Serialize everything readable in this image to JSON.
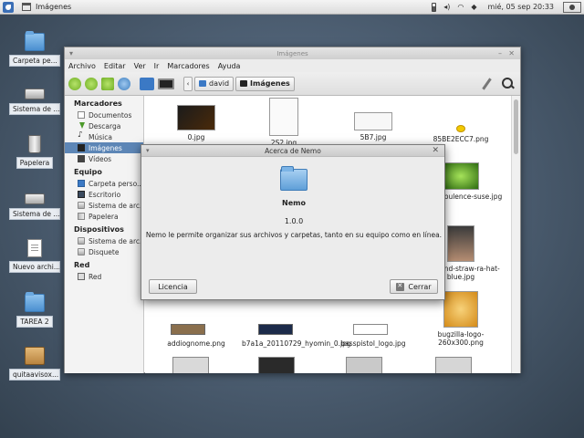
{
  "panel": {
    "task_title": "Imágenes",
    "datetime": "mié, 05 sep  20:33"
  },
  "desktop": {
    "icons": [
      {
        "label": "Carpeta pe...",
        "icon": "folder-icon"
      },
      {
        "label": "Sistema de ...",
        "icon": "drive-icon"
      },
      {
        "label": "Papelera",
        "icon": "trash-icon"
      },
      {
        "label": "Sistema de ...",
        "icon": "drive-icon"
      },
      {
        "label": "Nuevo archi...",
        "icon": "document-icon"
      },
      {
        "label": "TAREA 2",
        "icon": "folder-icon"
      },
      {
        "label": "quitaavisox...",
        "icon": "package-icon"
      }
    ]
  },
  "window": {
    "title": "Imágenes",
    "menu": [
      "Archivo",
      "Editar",
      "Ver",
      "Ir",
      "Marcadores",
      "Ayuda"
    ],
    "path": {
      "parent": "david",
      "current": "Imágenes"
    }
  },
  "sidebar": {
    "sections": [
      {
        "title": "Marcadores",
        "items": [
          {
            "label": "Documentos",
            "icon": "doc"
          },
          {
            "label": "Descarga",
            "icon": "down"
          },
          {
            "label": "Música",
            "icon": "music"
          },
          {
            "label": "Imágenes",
            "icon": "img",
            "selected": true
          },
          {
            "label": "Vídeos",
            "icon": "vid"
          }
        ]
      },
      {
        "title": "Equipo",
        "items": [
          {
            "label": "Carpeta perso...",
            "icon": "blue"
          },
          {
            "label": "Escritorio",
            "icon": "desk"
          },
          {
            "label": "Sistema de arc...",
            "icon": "hd"
          },
          {
            "label": "Papelera",
            "icon": "trash"
          }
        ]
      },
      {
        "title": "Dispositivos",
        "items": [
          {
            "label": "Sistema de arc...",
            "icon": "hd"
          },
          {
            "label": "Disquete",
            "icon": "hd"
          }
        ]
      },
      {
        "title": "Red",
        "items": [
          {
            "label": "Red",
            "icon": "net"
          }
        ]
      }
    ]
  },
  "files": {
    "row1": [
      "0.jpg",
      "2S2.jpg",
      "5B7.jpg",
      "85BE2ECC7.png"
    ],
    "row2_right": [
      "blueturbulence-suse.jpg"
    ],
    "row3_right": [
      "96-round-straw-ra-hat-blue.jpg"
    ],
    "row4": [
      "addiognome.png",
      "b7a1a_20110729_hyomin_0.jpg",
      "basspistol_logo.jpg",
      "bugzilla-logo-260x300.png"
    ]
  },
  "dialog": {
    "title": "Acerca de Nemo",
    "app_name": "Nemo",
    "version": "1.0.0",
    "description": "Nemo le permite organizar sus archivos y carpetas, tanto en su equipo como en línea.",
    "license_button": "Licencia",
    "close_button": "Cerrar"
  }
}
